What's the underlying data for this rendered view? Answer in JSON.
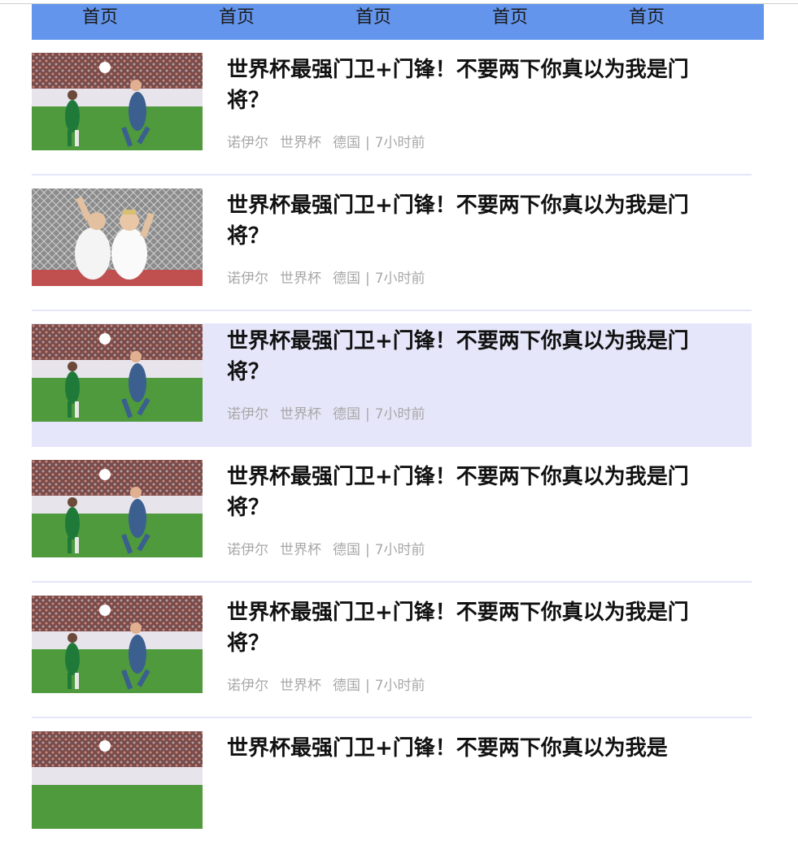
{
  "nav": {
    "items": [
      "首页",
      "首页",
      "首页",
      "首页",
      "首页"
    ]
  },
  "articles": [
    {
      "image": "soccer-match-green-vs-blue",
      "title": "世界杯最强门卫+门锋！不要两下你真以为我是门将？",
      "author": "诺伊尔",
      "category": "世界杯",
      "tag": "德国",
      "separator": "|",
      "time": "7小时前"
    },
    {
      "image": "soccer-players-white-jerseys-celebrating",
      "title": "世界杯最强门卫+门锋！不要两下你真以为我是门将？",
      "author": "诺伊尔",
      "category": "世界杯",
      "tag": "德国",
      "separator": "|",
      "time": "7小时前"
    },
    {
      "image": "soccer-match-green-vs-blue",
      "title": "世界杯最强门卫+门锋！不要两下你真以为我是门将？",
      "author": "诺伊尔",
      "category": "世界杯",
      "tag": "德国",
      "separator": "|",
      "time": "7小时前",
      "highlighted": true
    },
    {
      "image": "soccer-match-green-vs-blue",
      "title": "世界杯最强门卫+门锋！不要两下你真以为我是门将？",
      "author": "诺伊尔",
      "category": "世界杯",
      "tag": "德国",
      "separator": "|",
      "time": "7小时前"
    },
    {
      "image": "soccer-match-green-vs-blue",
      "title": "世界杯最强门卫+门锋！不要两下你真以为我是门将？",
      "author": "诺伊尔",
      "category": "世界杯",
      "tag": "德国",
      "separator": "|",
      "time": "7小时前"
    },
    {
      "image": "soccer-match-green-vs-blue",
      "title": "世界杯最强门卫+门锋！不要两下你真以为我是",
      "author": "",
      "category": "",
      "tag": "",
      "separator": "",
      "time": ""
    }
  ],
  "colors": {
    "nav_bg": "#6495ed",
    "highlight_bg": "#e6e6fa",
    "separator": "#e6e6fa",
    "meta_text": "#a8a8a8"
  }
}
